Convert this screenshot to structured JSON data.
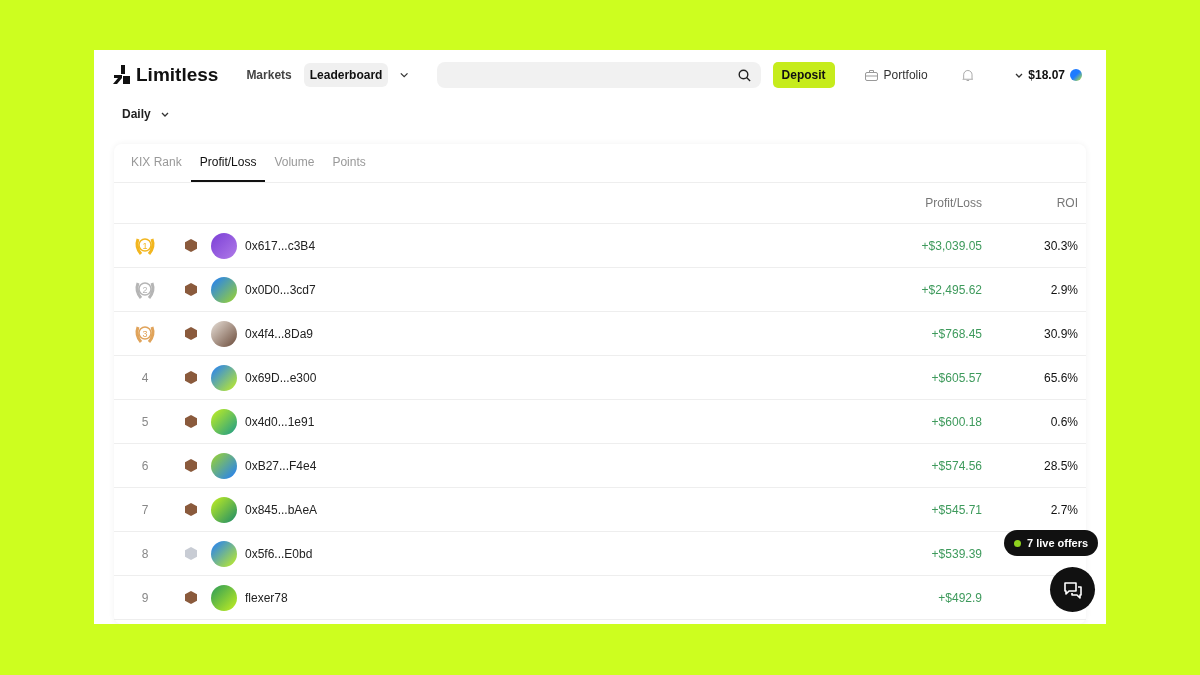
{
  "header": {
    "logo": "Limitless",
    "nav": [
      {
        "label": "Markets",
        "selected": false
      },
      {
        "label": "Leaderboard",
        "selected": true
      }
    ],
    "deposit": "Deposit",
    "portfolio": "Portfolio",
    "balance": "$18.07"
  },
  "period": "Daily",
  "tabs": [
    {
      "label": "KIX Rank",
      "selected": false
    },
    {
      "label": "Profit/Loss",
      "selected": true
    },
    {
      "label": "Volume",
      "selected": false
    },
    {
      "label": "Points",
      "selected": false
    }
  ],
  "columns": [
    "Profit/Loss",
    "ROI"
  ],
  "rows": [
    {
      "rank": "1",
      "kind": "medal",
      "color": "#f2b61f",
      "badge": {
        "color": "#8a5a3c"
      },
      "user": "0x617...c3B4",
      "pnl": "+$3,039.05",
      "roi": "30.3%"
    },
    {
      "rank": "2",
      "kind": "medal",
      "color": "#b5b5b5",
      "badge": {
        "color": "#8a5a3c"
      },
      "user": "0x0D0...3cd7",
      "pnl": "+$2,495.62",
      "roi": "2.9%"
    },
    {
      "rank": "3",
      "kind": "medal",
      "color": "#e0a35a",
      "badge": {
        "color": "#8a5a3c"
      },
      "user": "0x4f4...8Da9",
      "pnl": "+$768.45",
      "roi": "30.9%"
    },
    {
      "rank": "4",
      "kind": "number",
      "badge": {
        "color": "#8a5a3c"
      },
      "user": "0x69D...e300",
      "pnl": "+$605.57",
      "roi": "65.6%"
    },
    {
      "rank": "5",
      "kind": "number",
      "badge": {
        "color": "#8a5a3c"
      },
      "user": "0x4d0...1e91",
      "pnl": "+$600.18",
      "roi": "0.6%"
    },
    {
      "rank": "6",
      "kind": "number",
      "badge": {
        "color": "#8a5a3c"
      },
      "user": "0xB27...F4e4",
      "pnl": "+$574.56",
      "roi": "28.5%"
    },
    {
      "rank": "7",
      "kind": "number",
      "badge": {
        "color": "#8a5a3c"
      },
      "user": "0x845...bAeA",
      "pnl": "+$545.71",
      "roi": "2.7%"
    },
    {
      "rank": "8",
      "kind": "number",
      "badge": {
        "color": "#c8ccd4"
      },
      "user": "0x5f6...E0bd",
      "pnl": "+$539.39"
    },
    {
      "rank": "9",
      "kind": "number",
      "badge": {
        "color": "#8a5a3c"
      },
      "user": "flexer78",
      "pnl": "+$492.9"
    }
  ],
  "live_offers": "7 live offers"
}
